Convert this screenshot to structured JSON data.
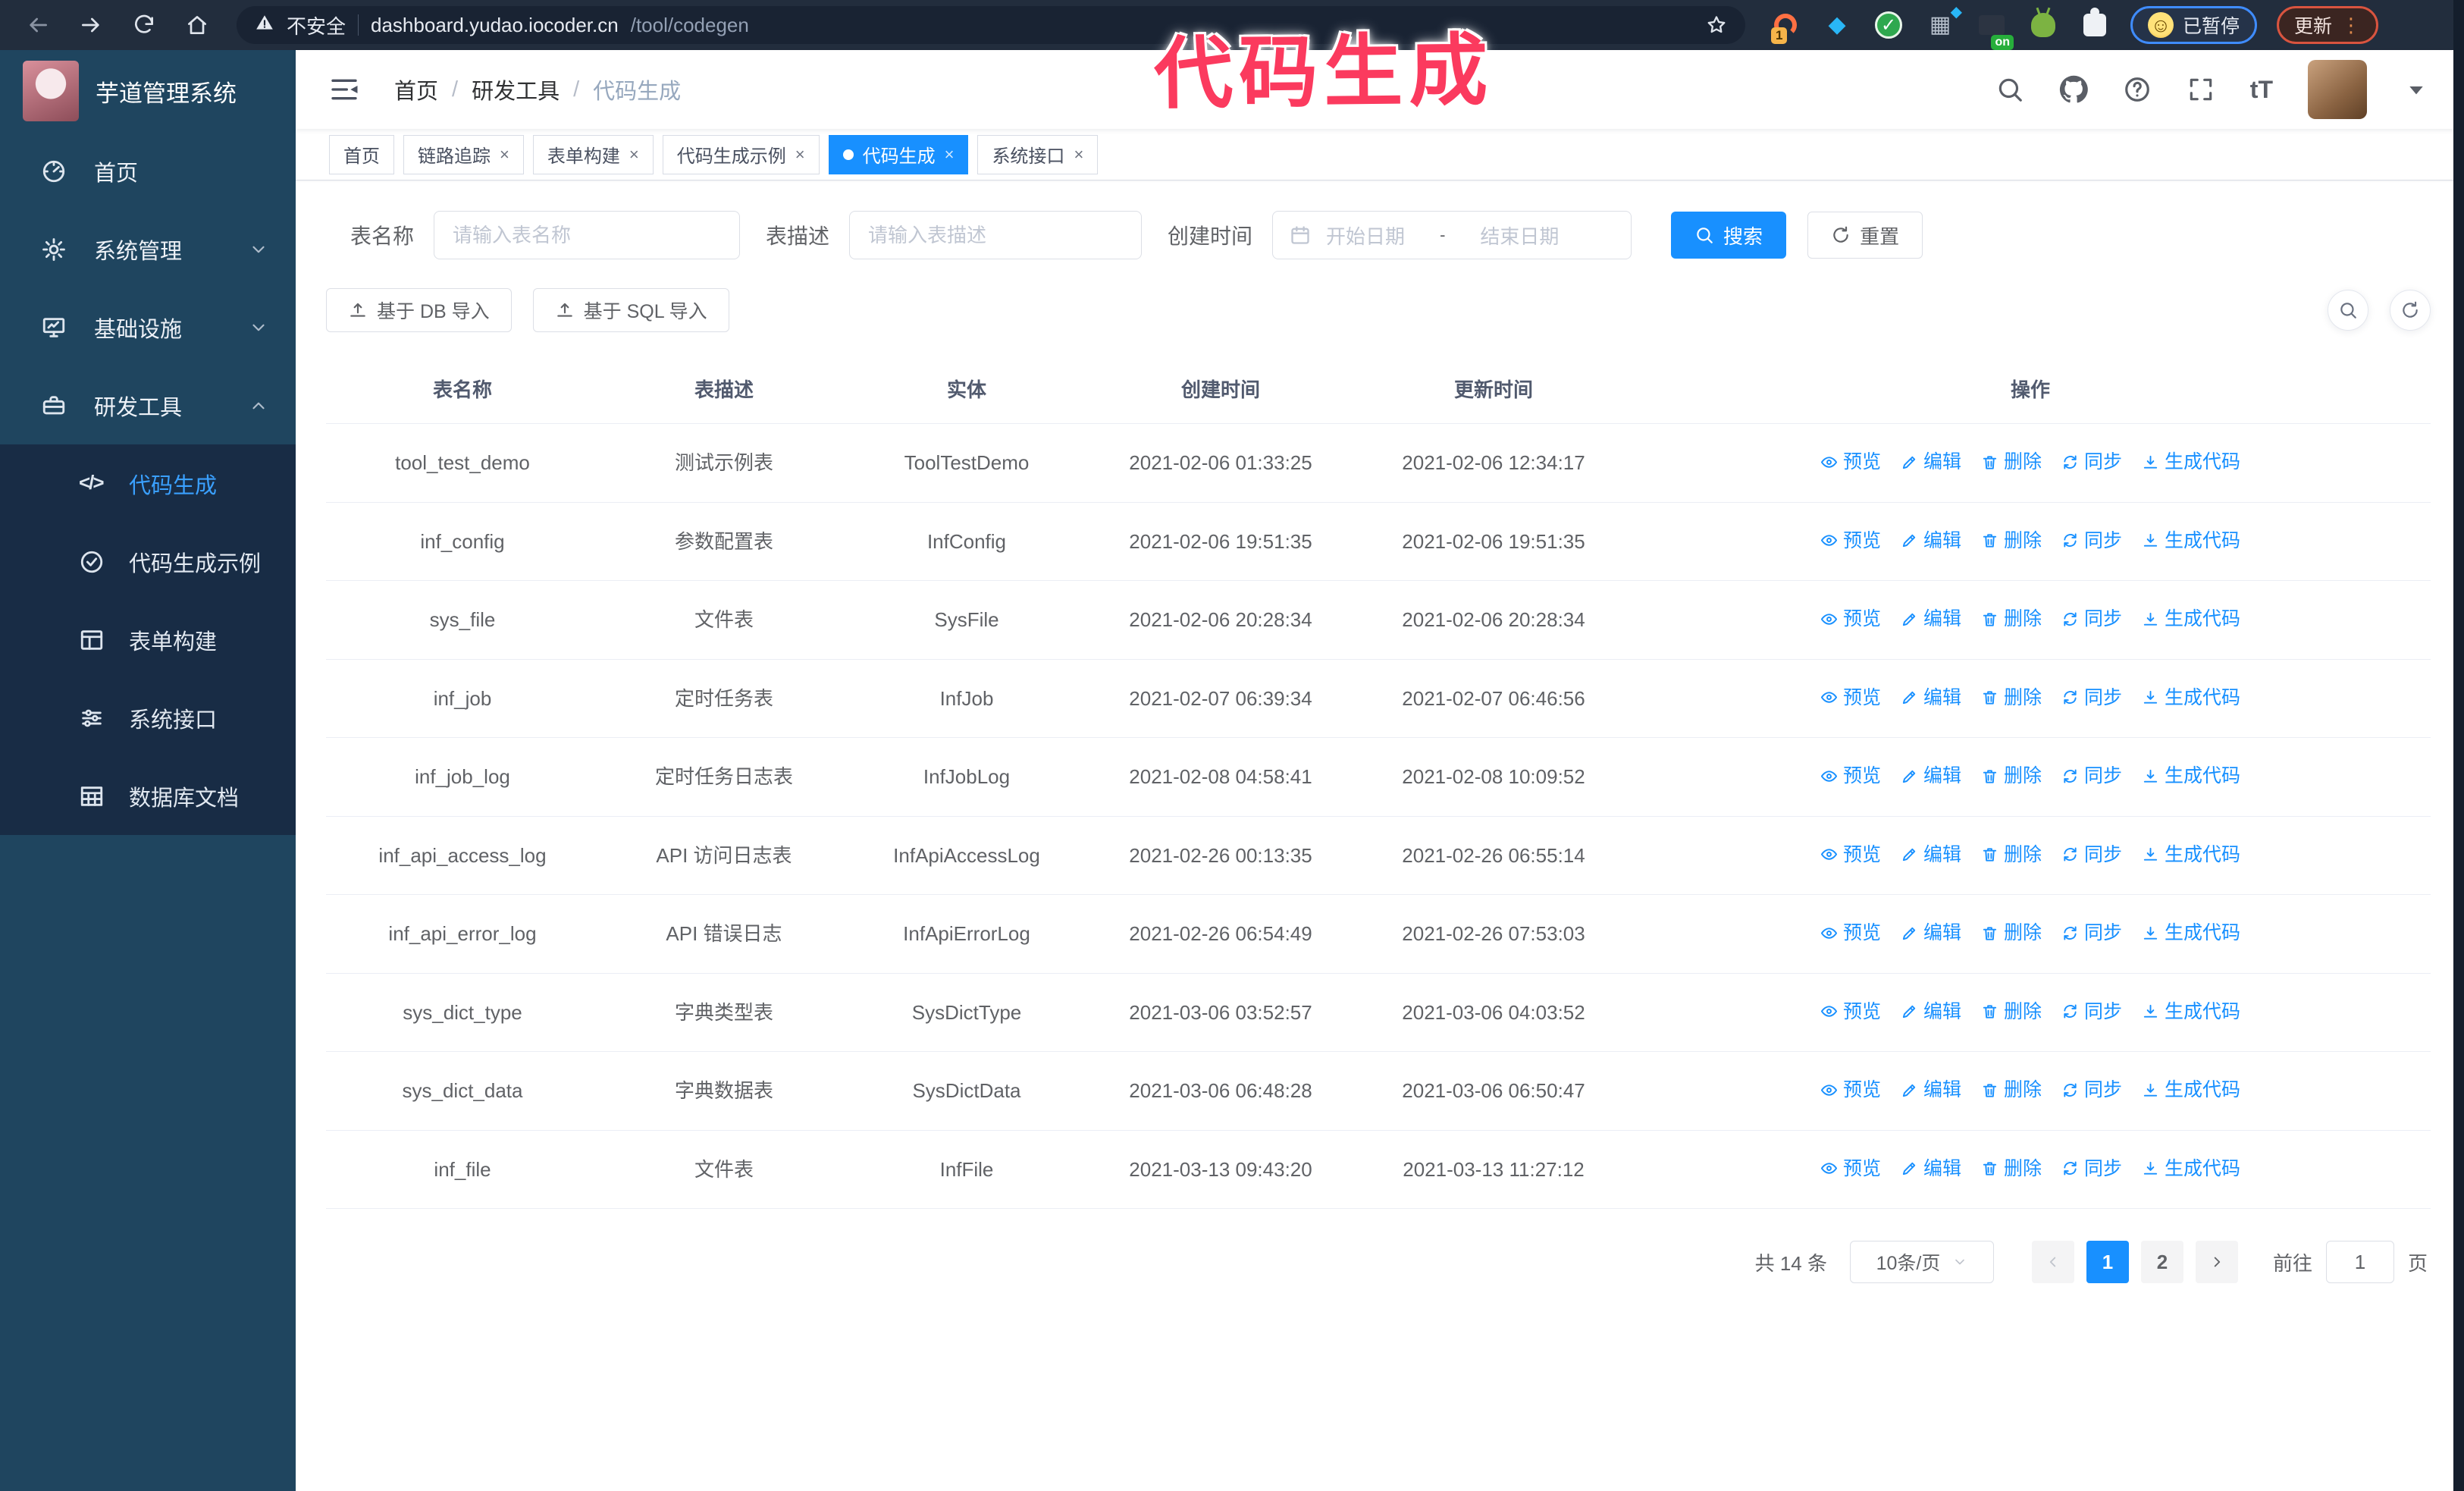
{
  "colors": {
    "accent": "#1890ff",
    "annotation": "#fb3a5e",
    "sidebar_bg": "#1f455f",
    "submenu_bg": "#182c45"
  },
  "annotation": {
    "text": "代码生成"
  },
  "browser": {
    "security_text": "不安全",
    "url_host": "dashboard.yudao.iocoder.cn",
    "url_path": "/tool/codegen",
    "ext_badge_1": "1",
    "ext_badge_on": "on",
    "paused_label": "已暂停",
    "update_label": "更新"
  },
  "sidebar": {
    "title": "芋道管理系统",
    "menu": [
      {
        "key": "home",
        "label": "首页",
        "icon": "dashboard",
        "chevron": ""
      },
      {
        "key": "system-management",
        "label": "系统管理",
        "icon": "gear",
        "chevron": "down"
      },
      {
        "key": "infrastructure",
        "label": "基础设施",
        "icon": "infra",
        "chevron": "down"
      },
      {
        "key": "dev-tools",
        "label": "研发工具",
        "icon": "tools",
        "chevron": "up"
      }
    ],
    "submenu": [
      {
        "key": "codegen",
        "label": "代码生成",
        "icon": "code",
        "active": true
      },
      {
        "key": "codegen-example",
        "label": "代码生成示例",
        "icon": "example",
        "active": false
      },
      {
        "key": "form-builder",
        "label": "表单构建",
        "icon": "form",
        "active": false
      },
      {
        "key": "system-api",
        "label": "系统接口",
        "icon": "api",
        "active": false
      },
      {
        "key": "db-doc",
        "label": "数据库文档",
        "icon": "db",
        "active": false
      }
    ]
  },
  "header": {
    "breadcrumb": [
      "首页",
      "研发工具",
      "代码生成"
    ]
  },
  "tabs": [
    {
      "key": "home",
      "label": "首页",
      "closable": false,
      "active": false
    },
    {
      "key": "trace",
      "label": "链路追踪",
      "closable": true,
      "active": false
    },
    {
      "key": "form-builder",
      "label": "表单构建",
      "closable": true,
      "active": false
    },
    {
      "key": "codegen-example",
      "label": "代码生成示例",
      "closable": true,
      "active": false
    },
    {
      "key": "codegen",
      "label": "代码生成",
      "closable": true,
      "active": true
    },
    {
      "key": "system-api",
      "label": "系统接口",
      "closable": true,
      "active": false
    }
  ],
  "filters": {
    "name_label": "表名称",
    "name_placeholder": "请输入表名称",
    "desc_label": "表描述",
    "desc_placeholder": "请输入表描述",
    "time_label": "创建时间",
    "start_placeholder": "开始日期",
    "range_separator": "-",
    "end_placeholder": "结束日期",
    "search_label": "搜索",
    "reset_label": "重置"
  },
  "import_buttons": {
    "db": "基于 DB 导入",
    "sql": "基于 SQL 导入"
  },
  "table": {
    "columns": [
      "表名称",
      "表描述",
      "实体",
      "创建时间",
      "更新时间",
      "操作"
    ],
    "actions": [
      {
        "key": "preview",
        "label": "预览",
        "icon": "eye"
      },
      {
        "key": "edit",
        "label": "编辑",
        "icon": "edit"
      },
      {
        "key": "delete",
        "label": "删除",
        "icon": "trash"
      },
      {
        "key": "sync",
        "label": "同步",
        "icon": "sync"
      },
      {
        "key": "generate",
        "label": "生成代码",
        "icon": "download"
      }
    ],
    "rows": [
      {
        "name": "tool_test_demo",
        "desc": "测试示例表",
        "entity": "ToolTestDemo",
        "created": "2021-02-06 01:33:25",
        "updated": "2021-02-06 12:34:17",
        "created_wrap": false,
        "updated_wrap": false
      },
      {
        "name": "inf_config",
        "desc": "参数配置表",
        "entity": "InfConfig",
        "created": "2021-02-06 19:51:35",
        "updated": "2021-02-06 19:51:35",
        "created_wrap": false,
        "updated_wrap": false
      },
      {
        "name": "sys_file",
        "desc": "文件表",
        "entity": "SysFile",
        "created": "2021-02-06 20:28:34",
        "updated": "2021-02-06 20:28:34",
        "created_wrap": true,
        "updated_wrap": true
      },
      {
        "name": "inf_job",
        "desc": "定时任务表",
        "entity": "InfJob",
        "created": "2021-02-07 06:39:34",
        "updated": "2021-02-07 06:46:56",
        "created_wrap": true,
        "updated_wrap": true
      },
      {
        "name": "inf_job_log",
        "desc": "定时任务日志表",
        "entity": "InfJobLog",
        "created": "2021-02-08 04:58:41",
        "updated": "2021-02-08 10:09:52",
        "created_wrap": true,
        "updated_wrap": true
      },
      {
        "name": "inf_api_access_log",
        "desc": "API 访问日志表",
        "entity": "InfApiAccessLog",
        "created": "2021-02-26 00:13:35",
        "updated": "2021-02-26 06:55:14",
        "created_wrap": false,
        "updated_wrap": true
      },
      {
        "name": "inf_api_error_log",
        "desc": "API 错误日志",
        "entity": "InfApiErrorLog",
        "created": "2021-02-26 06:54:49",
        "updated": "2021-02-26 07:53:03",
        "created_wrap": true,
        "updated_wrap": true
      },
      {
        "name": "sys_dict_type",
        "desc": "字典类型表",
        "entity": "SysDictType",
        "created": "2021-03-06 03:52:57",
        "updated": "2021-03-06 04:03:52",
        "created_wrap": true,
        "updated_wrap": true
      },
      {
        "name": "sys_dict_data",
        "desc": "字典数据表",
        "entity": "SysDictData",
        "created": "2021-03-06 06:48:28",
        "updated": "2021-03-06 06:50:47",
        "created_wrap": true,
        "updated_wrap": true
      },
      {
        "name": "inf_file",
        "desc": "文件表",
        "entity": "InfFile",
        "created": "2021-03-13 09:43:20",
        "updated": "2021-03-13 11:27:12",
        "created_wrap": true,
        "updated_wrap": false
      }
    ]
  },
  "pagination": {
    "total": "共 14 条",
    "page_size": "10条/页",
    "pages": [
      "1",
      "2"
    ],
    "active_page": "1",
    "goto_prefix": "前往",
    "goto_value": "1",
    "goto_suffix": "页"
  }
}
